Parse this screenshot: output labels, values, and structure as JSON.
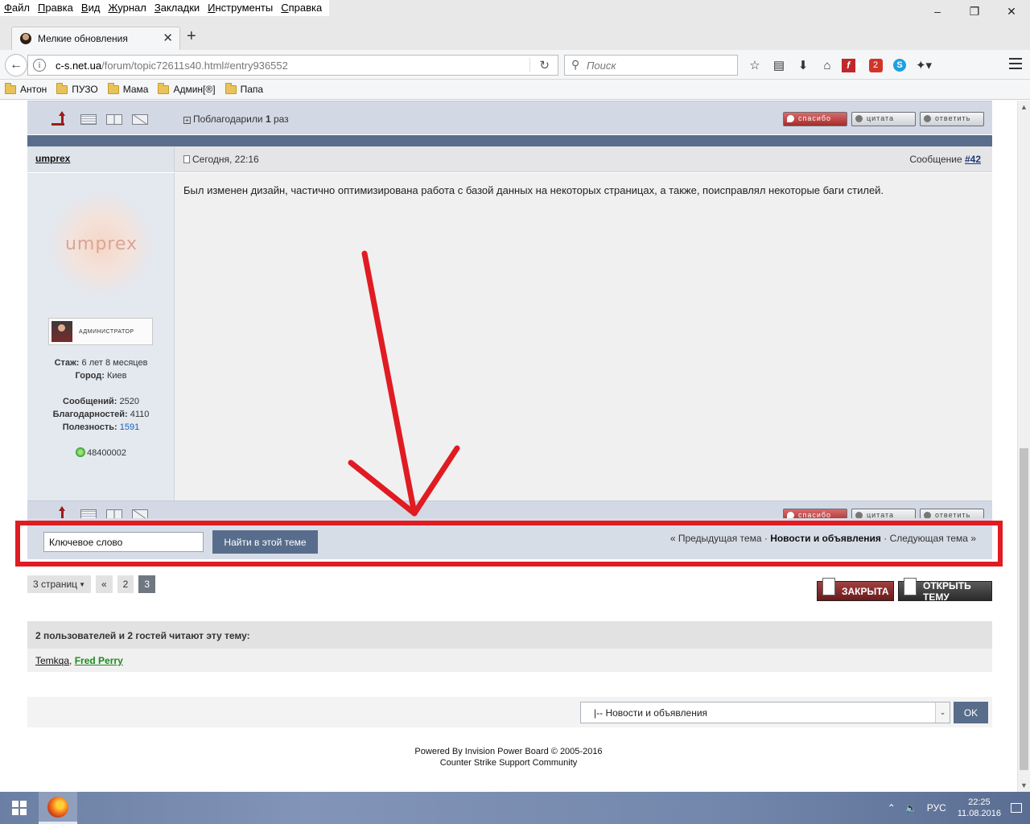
{
  "browser": {
    "menu": [
      "Файл",
      "Правка",
      "Вид",
      "Журнал",
      "Закладки",
      "Инструменты",
      "Справка"
    ],
    "tab_title": "Мелкие обновления",
    "url_host": "c-s.net.ua",
    "url_path": "/forum/topic72611s40.html#entry936552",
    "search_placeholder": "Поиск",
    "bookmarks": [
      "Антон",
      "ПУЗО",
      "Мама",
      "Админ[®]",
      "Папа"
    ],
    "toolbar_icons": [
      "star-icon",
      "reading-list-icon",
      "download-icon",
      "home-icon",
      "flash-icon",
      "adblock-icon",
      "skype-icon",
      "extension-icon",
      "menu-icon"
    ],
    "adblock_count": "2"
  },
  "post_actions": {
    "thanks_label": "Поблагодарили",
    "thanks_count": "1",
    "thanks_suffix": "раз",
    "btn_thanks": "спасибо",
    "btn_quote": "цитата",
    "btn_reply": "ответить"
  },
  "post": {
    "author": "umprex",
    "date": "Сегодня, 22:16",
    "number_label": "Сообщение",
    "number": "#42",
    "text": "Был изменен дизайн, частично оптимизирована работа с базой данных на некоторых страницах, а также, поисправлял некоторые баги стилей.",
    "avatar_text": "umprex",
    "rank": "администратор",
    "stats": {
      "tenure_label": "Стаж:",
      "tenure": "6 лет 8 месяцев",
      "city_label": "Город:",
      "city": "Киев",
      "posts_label": "Сообщений:",
      "posts": "2520",
      "thanks_label": "Благодарностей:",
      "thanks": "4110",
      "usefulness_label": "Полезность:",
      "usefulness": "1591",
      "icq": "48400002"
    }
  },
  "topic_search": {
    "input_value": "Ключевое слово",
    "button": "Найти в этой теме",
    "prev": "« Предыдущая тема",
    "sep": "·",
    "forum": "Новости и объявления",
    "next": "Следующая тема »"
  },
  "pager": {
    "pages_label": "3 страниц",
    "first": "«",
    "pages": [
      "2",
      "3"
    ],
    "current": "3"
  },
  "topic_buttons": {
    "closed": "ЗАКРЫТА",
    "open": "ОТКРЫТЬ ТЕМУ"
  },
  "readers": {
    "count_users": "2",
    "middle": "пользователей и",
    "count_guests": "2",
    "tail": "гостей читают эту тему:",
    "user1": "Temkqa",
    "sep": ",",
    "user2": "Fred Perry"
  },
  "jump": {
    "selected": "|-- Новости и объявления",
    "ok": "OK"
  },
  "footer": {
    "line1": "Powered By Invision Power Board  © 2005-2016",
    "line2": "Counter Strike Support Community"
  },
  "taskbar": {
    "lang": "РУС",
    "time": "22:25",
    "date": "11.08.2016"
  },
  "colors": {
    "highlight_box": "#e01b22",
    "header_band": "#5a6e8c",
    "button_blue": "#586d8c"
  }
}
